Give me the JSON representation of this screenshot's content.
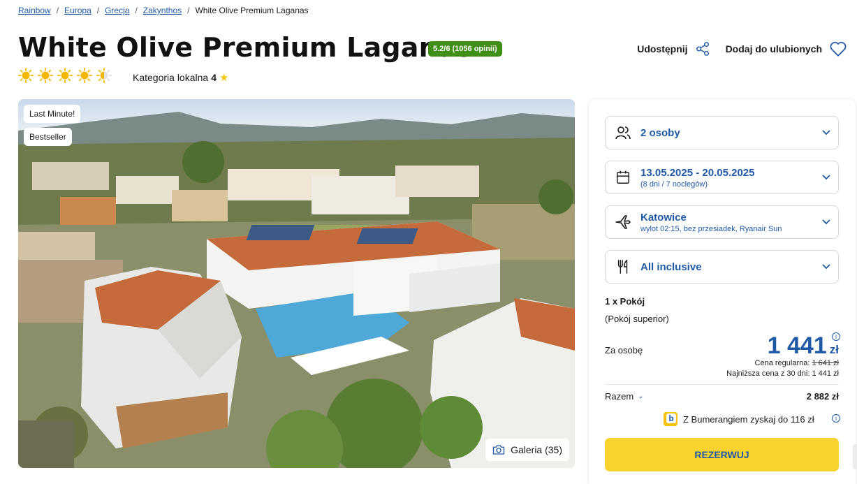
{
  "breadcrumb": {
    "items": [
      "Rainbow",
      "Europa",
      "Grecja",
      "Zakynthos"
    ],
    "current": "White Olive Premium Laganas"
  },
  "hotel": {
    "name": "White Olive Premium Laganas",
    "rating_badge": "5.2/6 (1056 opinii)",
    "sun_rating": 4.5,
    "local_category_label": "Kategoria lokalna",
    "local_category_value": "4"
  },
  "actions": {
    "share_label": "Udostępnij",
    "favorite_label": "Dodaj do ulubionych"
  },
  "gallery": {
    "tags": [
      "Last Minute!",
      "Bestseller"
    ],
    "button_label": "Galeria (35)"
  },
  "booking": {
    "guests": "2 osoby",
    "dates_main": "13.05.2025 - 20.05.2025",
    "dates_sub": "(8 dni / 7 noclegów)",
    "departure_main": "Katowice",
    "departure_sub": "wylot 02:15, bez przesiadek, Ryanair Sun",
    "board": "All inclusive",
    "room_count": "1 x Pokój",
    "room_type": "(Pokój superior)",
    "per_person_label": "Za osobę",
    "price_value": "1 441",
    "price_currency": "zł",
    "regular_label": "Cena regularna:",
    "regular_value": "1 641 zł",
    "lowest_label": "Najniższa cena z 30 dni: 1 441 zł",
    "total_label": "Razem",
    "total_value": "2 882 zł",
    "boomerang_text": "Z Bumerangiem zyskaj do 116 zł",
    "book_label": "REZERWUJ"
  },
  "colors": {
    "brand_blue": "#1f5aa6",
    "badge_green": "#3f8f16",
    "book_yellow": "#f8d32d",
    "sun_yellow": "#f5b800"
  }
}
